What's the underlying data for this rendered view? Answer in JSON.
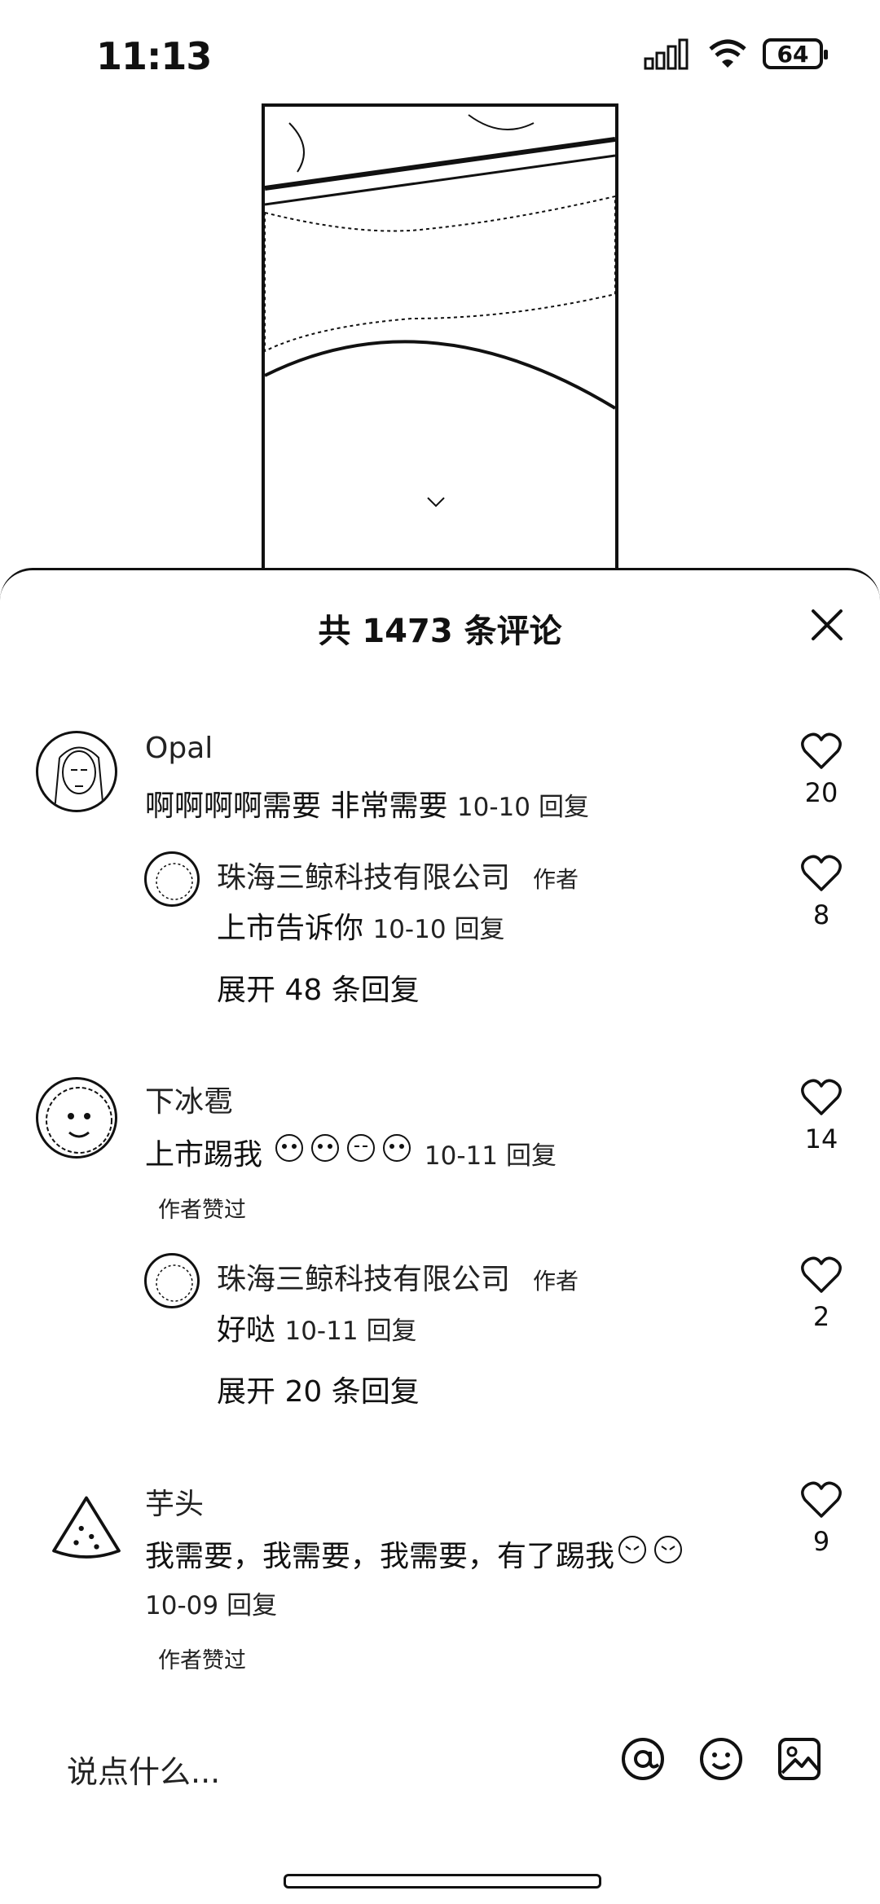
{
  "status_bar": {
    "time": "11:13",
    "battery": "64"
  },
  "sheet": {
    "title": "共 1473 条评论"
  },
  "comments": [
    {
      "user": "Opal",
      "text": "啊啊啊啊需要 非常需要",
      "date": "10-10",
      "reply_label": "回复",
      "likes": "20",
      "reply": {
        "user": "珠海三鲸科技有限公司",
        "tag": "作者",
        "text": "上市告诉你",
        "date": "10-10",
        "reply_label": "回复",
        "likes": "8"
      },
      "expand": "展开 48 条回复"
    },
    {
      "user": "下冰雹",
      "text": "上市踢我",
      "date": "10-11",
      "reply_label": "回复",
      "likes": "14",
      "liked_by_author": "作者赞过",
      "reply": {
        "user": "珠海三鲸科技有限公司",
        "tag": "作者",
        "text": "好哒",
        "date": "10-11",
        "reply_label": "回复",
        "likes": "2"
      },
      "expand": "展开 20 条回复"
    },
    {
      "user": "芋头",
      "text": "我需要，我需要，我需要，有了踢我",
      "date": "10-09",
      "reply_label": "回复",
      "likes": "9",
      "liked_by_author": "作者赞过"
    }
  ],
  "input": {
    "placeholder": "说点什么..."
  },
  "icons": [
    "at-icon",
    "emoji-icon",
    "image-icon",
    "heart-icon",
    "close-icon"
  ]
}
